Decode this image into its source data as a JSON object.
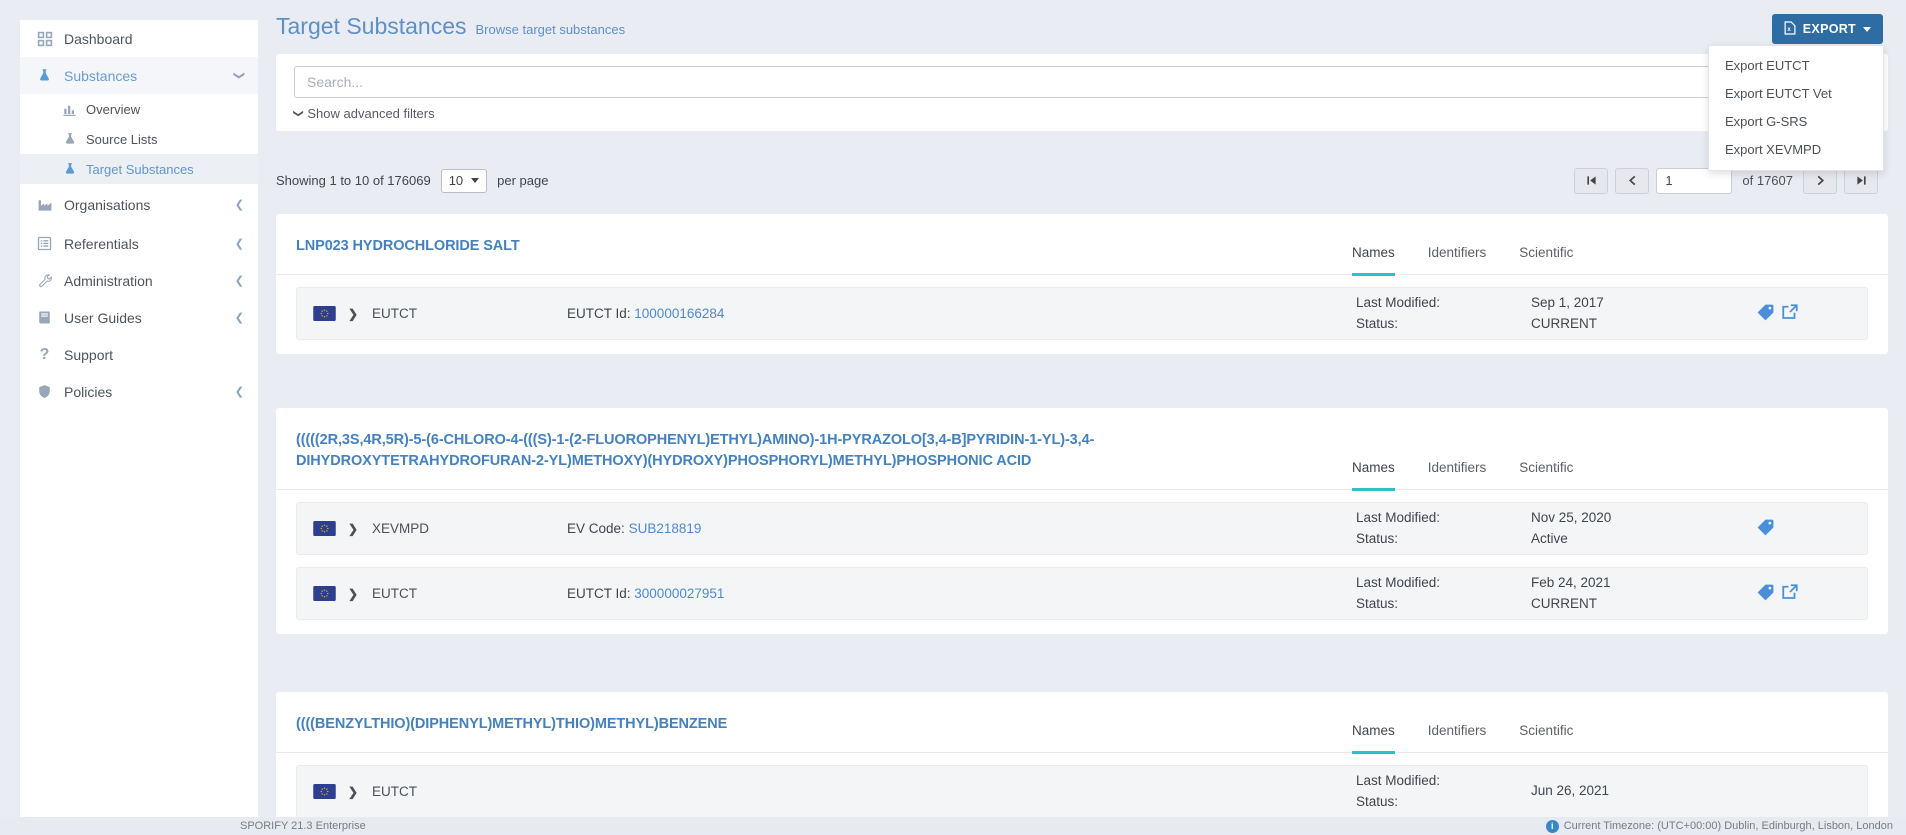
{
  "sidebar": {
    "items": [
      {
        "label": "Dashboard"
      },
      {
        "label": "Substances"
      },
      {
        "label": "Overview"
      },
      {
        "label": "Source Lists"
      },
      {
        "label": "Target Substances"
      },
      {
        "label": "Organisations"
      },
      {
        "label": "Referentials"
      },
      {
        "label": "Administration"
      },
      {
        "label": "User Guides"
      },
      {
        "label": "Support"
      },
      {
        "label": "Policies"
      }
    ]
  },
  "header": {
    "title": "Target Substances",
    "subtitle": "Browse target substances"
  },
  "export": {
    "label": "EXPORT",
    "items": [
      {
        "label": "Export EUTCT"
      },
      {
        "label": "Export EUTCT Vet"
      },
      {
        "label": "Export G-SRS"
      },
      {
        "label": "Export XEVMPD"
      }
    ]
  },
  "search": {
    "placeholder": "Search...",
    "advanced_filters": "Show advanced filters"
  },
  "pagination": {
    "showing": "Showing 1 to 10 of 176069",
    "page_size": "10",
    "per_page": "per page",
    "page": "1",
    "of": "of 17607"
  },
  "tabs": [
    "Names",
    "Identifiers",
    "Scientific"
  ],
  "labels": {
    "last_modified": "Last Modified:",
    "status": "Status:"
  },
  "cards": [
    {
      "title": "LNP023 HYDROCHLORIDE SALT",
      "rows": [
        {
          "source": "EUTCT",
          "id_label": "EUTCT Id:",
          "id_value": "100000166284",
          "last_modified": "Sep 1, 2017",
          "status": "CURRENT"
        }
      ]
    },
    {
      "title": "(((((2R,3S,4R,5R)-5-(6-CHLORO-4-(((S)-1-(2-FLUOROPHENYL)ETHYL)AMINO)-1H-PYRAZOLO[3,4-B]PYRIDIN-1-YL)-3,4-DIHYDROXYTETRAHYDROFURAN-2-YL)METHOXY)(HYDROXY)PHOSPHORYL)METHYL)PHOSPHONIC ACID",
      "rows": [
        {
          "source": "XEVMPD",
          "id_label": "EV Code:",
          "id_value": "SUB218819",
          "last_modified": "Nov 25, 2020",
          "status": "Active"
        },
        {
          "source": "EUTCT",
          "id_label": "EUTCT Id:",
          "id_value": "300000027951",
          "last_modified": "Feb 24, 2021",
          "status": "CURRENT"
        }
      ]
    },
    {
      "title": "((((BENZYLTHIO)(DIPHENYL)METHYL)THIO)METHYL)BENZENE",
      "rows": [
        {
          "source": "EUTCT",
          "id_label": "",
          "id_value": "",
          "last_modified": "Jun 26, 2021",
          "status": ""
        }
      ]
    }
  ],
  "footer": {
    "left": "SPORIFY 21.3 Enterprise",
    "right": "Current Timezone: (UTC+00:00) Dublin, Edinburgh, Lisbon, London"
  },
  "colors": {
    "accent_blue": "#2d6da3",
    "link_blue": "#5089c9",
    "tab_teal": "#2ac0cc"
  }
}
